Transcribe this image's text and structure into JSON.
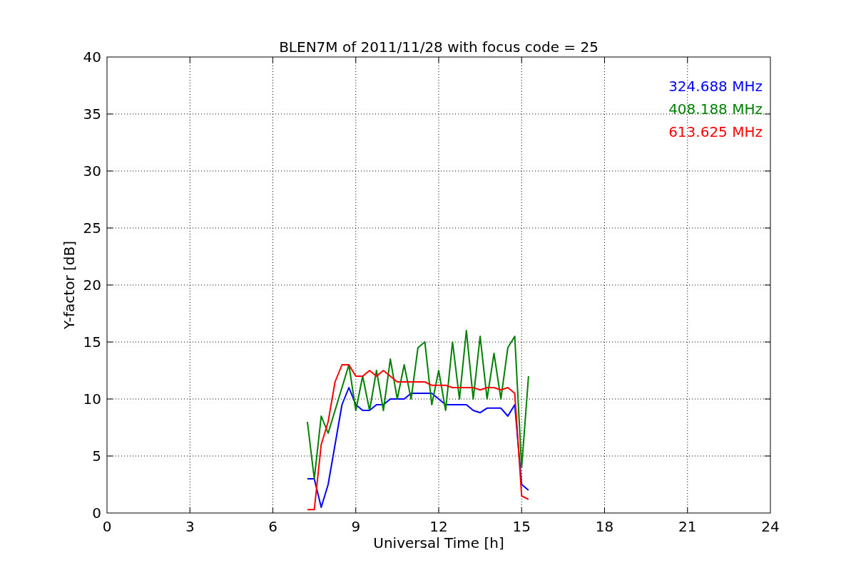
{
  "figure": {
    "chart_data": {
      "type": "line",
      "title": "BLEN7M of 2011/11/28 with focus code = 25",
      "xlabel": "Universal Time [h]",
      "ylabel": "Y-factor [dB]",
      "x": [
        7.25,
        7.5,
        7.75,
        8,
        8.25,
        8.5,
        8.75,
        9,
        9.25,
        9.5,
        9.75,
        10,
        10.25,
        10.5,
        10.75,
        11,
        11.25,
        11.5,
        11.75,
        12,
        12.25,
        12.5,
        12.75,
        13,
        13.25,
        13.5,
        13.75,
        14,
        14.25,
        14.5,
        14.75,
        15,
        15.25
      ],
      "series": [
        {
          "name": "324.688 MHz",
          "color": "#0000ff",
          "values": [
            3,
            3,
            0.5,
            2.5,
            6,
            9.5,
            11,
            9.5,
            9,
            9,
            9.5,
            9.5,
            10,
            10,
            10,
            10.5,
            10.5,
            10.5,
            10.5,
            10,
            9.5,
            9.5,
            9.5,
            9.5,
            9,
            8.8,
            9.2,
            9.2,
            9.2,
            8.5,
            9.5,
            2.5,
            2
          ]
        },
        {
          "name": "408.188 MHz",
          "color": "#008000",
          "values": [
            8,
            3,
            8.5,
            7,
            9,
            11,
            13,
            9,
            12,
            9,
            12.5,
            9,
            13.5,
            10,
            13,
            10,
            14.5,
            15,
            9.5,
            12.5,
            9,
            15,
            10,
            16,
            10,
            15.5,
            10,
            14,
            10,
            14.5,
            15.5,
            4,
            12
          ]
        },
        {
          "name": "613.625 MHz",
          "color": "#ff0000",
          "values": [
            0.3,
            0.3,
            6,
            8,
            11.5,
            13,
            13,
            12,
            12,
            12.5,
            12,
            12.5,
            12,
            11.5,
            11.5,
            11.5,
            11.5,
            11.5,
            11.2,
            11.2,
            11.2,
            11,
            11,
            11,
            11,
            10.8,
            11,
            11,
            10.8,
            11,
            10.5,
            1.5,
            1.2
          ]
        }
      ],
      "grid": true,
      "xlim": [
        0,
        24
      ],
      "ylim": [
        0,
        40
      ],
      "xticks": [
        0,
        3,
        6,
        9,
        12,
        15,
        18,
        21,
        24
      ],
      "yticks": [
        0,
        5,
        10,
        15,
        20,
        25,
        30,
        35,
        40
      ]
    }
  }
}
